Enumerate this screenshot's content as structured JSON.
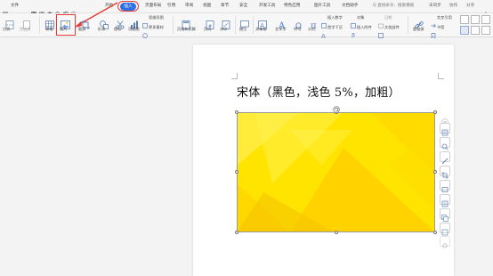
{
  "menu": {
    "file": "文件",
    "items_start": "开始",
    "tab_insert": "插入",
    "tab_layout": "页面布局",
    "tab_references": "引用",
    "tab_review": "审阅",
    "tab_view": "视图",
    "tab_chapter": "章节",
    "tab_security": "安全",
    "tab_dev": "开发工具",
    "tab_special": "特色应用",
    "tab_image_tools": "图片工具",
    "tab_docassist": "文档助手",
    "search_placeholder": "Q 查找命令、搜索模板",
    "unsynced": "未同步",
    "collab": "协作",
    "share": "分享"
  },
  "ribbon": {
    "page_break": "分页",
    "blank_page": "空白页",
    "table": "表格",
    "picture": "图片",
    "screenshot": "截屏",
    "shape": "形状",
    "icon": "图标",
    "functional_chart": "功能图",
    "flowchart": "思维导图",
    "more": "更多素材",
    "header_footer": "页眉和页脚",
    "page_number": "页码",
    "watermark": "水印",
    "comment": "批注",
    "textbox": "文本框",
    "wordart": "艺术字",
    "symbol": "符号",
    "formula": "公式",
    "insert_number": "插入数字",
    "object": "对象",
    "date": "日期",
    "drop_cap": "首字下沉",
    "attachment": "插入附件",
    "doc_parts": "文档部件",
    "hyperlink": "超链接",
    "crossref": "交叉引用",
    "bookmark": "书签"
  },
  "document": {
    "heading": "宋体（黑色，浅色 5%，加粗）"
  },
  "colors": {
    "accent": "#2f6fe0",
    "highlight": "#e53935",
    "image_yellow": "#ffe400"
  }
}
